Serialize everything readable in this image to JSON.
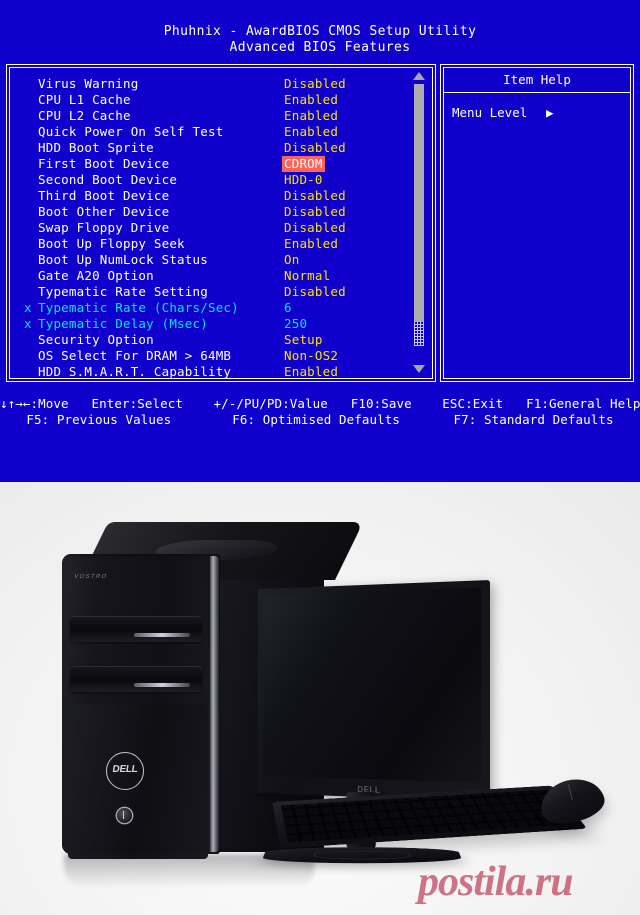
{
  "bios": {
    "title": "Phuhnix - AwardBIOS CMOS Setup Utility",
    "subtitle": "Advanced BIOS Features",
    "colors": {
      "background": "#1000cc",
      "label": "#ffffff",
      "value": "#ffe400",
      "dimmed": "#00e4e4",
      "highlight_bg": "#fa6359",
      "highlight_fg": "#ffffff",
      "scrollbar": "#adadad"
    },
    "options": [
      {
        "mark": "",
        "label": "Virus Warning",
        "value": "Disabled",
        "dimmed": false,
        "selected": false
      },
      {
        "mark": "",
        "label": "CPU L1 Cache",
        "value": "Enabled",
        "dimmed": false,
        "selected": false
      },
      {
        "mark": "",
        "label": "CPU L2 Cache",
        "value": "Enabled",
        "dimmed": false,
        "selected": false
      },
      {
        "mark": "",
        "label": "Quick Power On Self Test",
        "value": "Enabled",
        "dimmed": false,
        "selected": false
      },
      {
        "mark": "",
        "label": "HDD Boot Sprite",
        "value": "Disabled",
        "dimmed": false,
        "selected": false
      },
      {
        "mark": "",
        "label": "First Boot Device",
        "value": "CDROM",
        "dimmed": false,
        "selected": true
      },
      {
        "mark": "",
        "label": "Second Boot Device",
        "value": "HDD-0",
        "dimmed": false,
        "selected": false
      },
      {
        "mark": "",
        "label": "Third Boot Device",
        "value": "Disabled",
        "dimmed": false,
        "selected": false
      },
      {
        "mark": "",
        "label": "Boot Other Device",
        "value": "Disabled",
        "dimmed": false,
        "selected": false
      },
      {
        "mark": "",
        "label": "Swap Floppy Drive",
        "value": "Disabled",
        "dimmed": false,
        "selected": false
      },
      {
        "mark": "",
        "label": "Boot Up Floppy Seek",
        "value": "Enabled",
        "dimmed": false,
        "selected": false
      },
      {
        "mark": "",
        "label": "Boot Up NumLock Status",
        "value": "On",
        "dimmed": false,
        "selected": false
      },
      {
        "mark": "",
        "label": "Gate A20 Option",
        "value": "Normal",
        "dimmed": false,
        "selected": false
      },
      {
        "mark": "",
        "label": "Typematic Rate Setting",
        "value": "Disabled",
        "dimmed": false,
        "selected": false
      },
      {
        "mark": "x",
        "label": "Typematic Rate (Chars/Sec)",
        "value": "6",
        "dimmed": true,
        "selected": false
      },
      {
        "mark": "x",
        "label": "Typematic Delay (Msec)",
        "value": "250",
        "dimmed": true,
        "selected": false
      },
      {
        "mark": "",
        "label": "Security Option",
        "value": "Setup",
        "dimmed": false,
        "selected": false
      },
      {
        "mark": "",
        "label": "OS Select For DRAM > 64MB",
        "value": "Non-OS2",
        "dimmed": false,
        "selected": false
      },
      {
        "mark": "",
        "label": "HDD S.M.A.R.T. Capability",
        "value": "Enabled",
        "dimmed": false,
        "selected": false
      }
    ],
    "help": {
      "title": "Item Help",
      "menu_level_label": "Menu Level",
      "menu_level_arrow": "▶"
    },
    "legend": {
      "line1": "↓↑→←:Move   Enter:Select    +/-/PU/PD:Value   F10:Save    ESC:Exit   F1:General Help",
      "line2": "F5: Previous Values        F6: Optimised Defaults       F7: Standard Defaults"
    },
    "scrollbar": {
      "up_arrow": "▲",
      "down_arrow": "▼"
    }
  },
  "photo": {
    "tower_brand": "DELL",
    "tower_series": "VOSTRO",
    "monitor_brand": "DELL"
  },
  "watermark": {
    "text": "postila.ru",
    "color": "#c9687a"
  }
}
